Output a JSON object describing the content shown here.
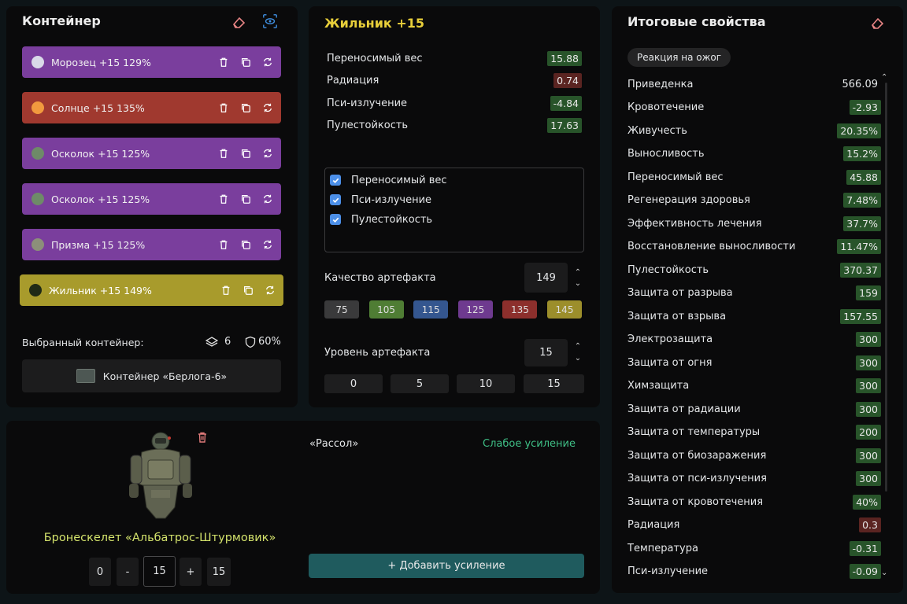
{
  "container": {
    "title": "Контейнер",
    "artifacts": [
      {
        "label": "Морозец +15 129%",
        "bg": "#7a3e9d",
        "icon_color": "#d9d9e8",
        "icon": "snowflake-icon"
      },
      {
        "label": "Солнце +15 135%",
        "bg": "#a0392f",
        "icon_color": "#f29a3e",
        "icon": "sun-icon"
      },
      {
        "label": "Осколок +15 125%",
        "bg": "#7a3e9d",
        "icon_color": "#6e8a68",
        "icon": "shard-icon"
      },
      {
        "label": "Осколок +15 125%",
        "bg": "#7a3e9d",
        "icon_color": "#6e8a68",
        "icon": "shard-icon"
      },
      {
        "label": "Призма +15 125%",
        "bg": "#7a3e9d",
        "icon_color": "#8c8f7a",
        "icon": "prism-icon"
      },
      {
        "label": "Жильник +15 149%",
        "bg": "#a89b2c",
        "icon_color": "#1f2a16",
        "icon": "vein-icon"
      }
    ],
    "selected_label": "Выбранный контейнер:",
    "slots": "6",
    "protection": "60%",
    "container_name": "Контейнер «Берлога-6»"
  },
  "artifact": {
    "title": "Жильник +15",
    "props": [
      {
        "name": "Переносимый вес",
        "value": "15.88",
        "type": "pos"
      },
      {
        "name": "Радиация",
        "value": "0.74",
        "type": "neg"
      },
      {
        "name": "Пси-излучение",
        "value": "-4.84",
        "type": "pos"
      },
      {
        "name": "Пулестойкость",
        "value": "17.63",
        "type": "pos"
      }
    ],
    "checks": [
      "Переносимый вес",
      "Пси-излучение",
      "Пулестойкость"
    ],
    "quality_label": "Качество артефакта",
    "quality_value": "149",
    "quality_presets": [
      {
        "label": "75",
        "color": "#3a3a3b"
      },
      {
        "label": "105",
        "color": "#4f7d34"
      },
      {
        "label": "115",
        "color": "#34568f"
      },
      {
        "label": "125",
        "color": "#6e3a8f"
      },
      {
        "label": "135",
        "color": "#8c2f2c"
      },
      {
        "label": "145",
        "color": "#9c8e2b"
      }
    ],
    "level_label": "Уровень артефакта",
    "level_value": "15",
    "level_presets": [
      "0",
      "5",
      "10",
      "15"
    ]
  },
  "totals": {
    "title": "Итоговые свойства",
    "tag": "Реакция на ожог",
    "stats": [
      {
        "name": "Приведенка",
        "value": "566.09",
        "type": "plain"
      },
      {
        "name": "Кровотечение",
        "value": "-2.93",
        "type": "pos"
      },
      {
        "name": "Живучесть",
        "value": "20.35%",
        "type": "pos"
      },
      {
        "name": "Выносливость",
        "value": "15.2%",
        "type": "pos"
      },
      {
        "name": "Переносимый вес",
        "value": "45.88",
        "type": "pos"
      },
      {
        "name": "Регенерация здоровья",
        "value": "7.48%",
        "type": "pos"
      },
      {
        "name": "Эффективность лечения",
        "value": "37.7%",
        "type": "pos"
      },
      {
        "name": "Восстановление выносливости",
        "value": "11.47%",
        "type": "pos"
      },
      {
        "name": "Пулестойкость",
        "value": "370.37",
        "type": "pos"
      },
      {
        "name": "Защита от разрыва",
        "value": "159",
        "type": "pos"
      },
      {
        "name": "Защита от взрыва",
        "value": "157.55",
        "type": "pos"
      },
      {
        "name": "Электрозащита",
        "value": "300",
        "type": "pos"
      },
      {
        "name": "Защита от огня",
        "value": "300",
        "type": "pos"
      },
      {
        "name": "Химзащита",
        "value": "300",
        "type": "pos"
      },
      {
        "name": "Защита от радиации",
        "value": "300",
        "type": "pos"
      },
      {
        "name": "Защита от температуры",
        "value": "200",
        "type": "pos"
      },
      {
        "name": "Защита от биозаражения",
        "value": "300",
        "type": "pos"
      },
      {
        "name": "Защита от пси-излучения",
        "value": "300",
        "type": "pos"
      },
      {
        "name": "Защита от кровотечения",
        "value": "40%",
        "type": "pos"
      },
      {
        "name": "Радиация",
        "value": "0.3",
        "type": "neg"
      },
      {
        "name": "Температура",
        "value": "-0.31",
        "type": "pos"
      },
      {
        "name": "Пси-излучение",
        "value": "-0.09",
        "type": "pos"
      }
    ]
  },
  "armor": {
    "name": "Бронескелет «Альбатрос-Штурмовик»",
    "min": "0",
    "minus": "-",
    "current": "15",
    "plus": "+",
    "max": "15",
    "upgrade_name": "«Рассол»",
    "upgrade_status": "Слабое усиление",
    "add_upgrade": "+ Добавить усиление"
  },
  "colors": {
    "accent_yellow": "#e8cf3a",
    "armor_name": "#d4e36c",
    "upgrade_status": "#3fbf86",
    "add_upgrade_bg": "#1f5b5e"
  }
}
